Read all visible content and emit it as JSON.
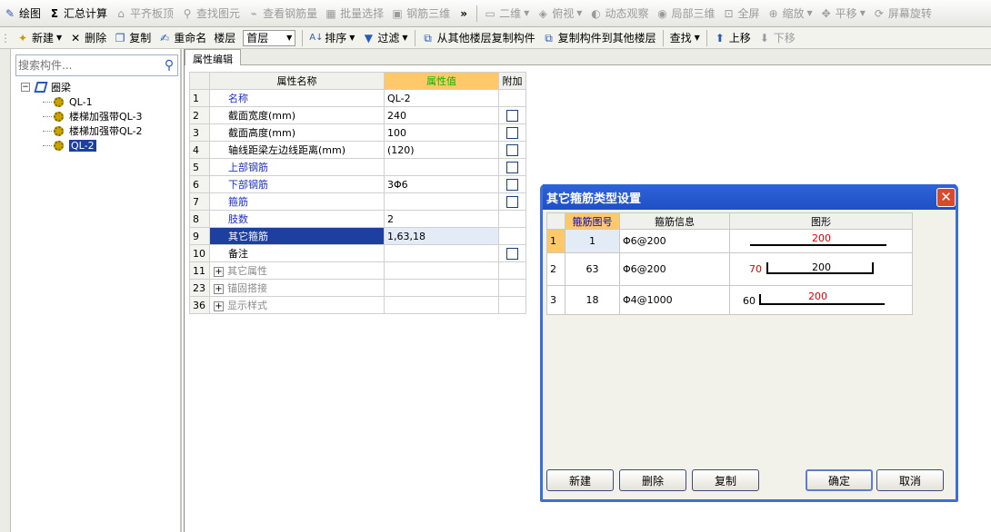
{
  "toolbar1": {
    "items": [
      {
        "label": "绘图",
        "icon": "draw-icon",
        "enabled": true
      },
      {
        "label": "汇总计算",
        "icon": "sigma-icon",
        "enabled": true
      },
      {
        "label": "平齐板顶",
        "icon": "align-icon",
        "enabled": false
      },
      {
        "label": "查找图元",
        "icon": "binoculars-icon",
        "enabled": false
      },
      {
        "label": "查看钢筋量",
        "icon": "view-rebar-icon",
        "enabled": false
      },
      {
        "label": "批量选择",
        "icon": "batch-select-icon",
        "enabled": false
      },
      {
        "label": "钢筋三维",
        "icon": "rebar-3d-icon",
        "enabled": false
      }
    ],
    "overflow": "»",
    "items_right": [
      {
        "label": "二维",
        "icon": "2d-icon",
        "dropdown": true
      },
      {
        "label": "俯视",
        "icon": "topview-icon",
        "dropdown": true
      },
      {
        "label": "动态观察",
        "icon": "orbit-icon",
        "dropdown": false
      },
      {
        "label": "局部三维",
        "icon": "local-3d-icon",
        "dropdown": false
      },
      {
        "label": "全屏",
        "icon": "fullscreen-icon",
        "dropdown": false
      },
      {
        "label": "缩放",
        "icon": "zoom-icon",
        "dropdown": true
      },
      {
        "label": "平移",
        "icon": "pan-icon",
        "dropdown": true
      },
      {
        "label": "屏幕旋转",
        "icon": "rotate-icon",
        "dropdown": false
      }
    ]
  },
  "toolbar2": {
    "new_label": "新建",
    "delete_label": "删除",
    "copy_label": "复制",
    "rename_label": "重命名",
    "floor_label": "楼层",
    "floor_value": "首层",
    "sort_label": "排序",
    "filter_label": "过滤",
    "copy_from_floor_label": "从其他楼层复制构件",
    "copy_to_floor_label": "复制构件到其他楼层",
    "find_label": "查找",
    "move_up_label": "上移",
    "move_down_label": "下移"
  },
  "left_panel": {
    "search_placeholder": "搜索构件...",
    "tree": {
      "root_label": "圈梁",
      "items": [
        "QL-1",
        "楼梯加强带QL-3",
        "楼梯加强带QL-2",
        "QL-2"
      ],
      "selected": "QL-2"
    }
  },
  "property_panel": {
    "tab_label": "属性编辑",
    "columns": [
      "属性名称",
      "属性值",
      "附加"
    ],
    "rows": [
      {
        "num": "1",
        "name": "名称",
        "value": "QL-2",
        "style": "blue",
        "checkbox": false
      },
      {
        "num": "2",
        "name": "截面宽度(mm)",
        "value": "240",
        "style": "black",
        "checkbox": true
      },
      {
        "num": "3",
        "name": "截面高度(mm)",
        "value": "100",
        "style": "black",
        "checkbox": true
      },
      {
        "num": "4",
        "name": "轴线距梁左边线距离(mm)",
        "value": "(120)",
        "style": "black",
        "checkbox": true
      },
      {
        "num": "5",
        "name": "上部钢筋",
        "value": "",
        "style": "blue",
        "checkbox": true
      },
      {
        "num": "6",
        "name": "下部钢筋",
        "value": "3Φ6",
        "style": "blue",
        "checkbox": true
      },
      {
        "num": "7",
        "name": "箍筋",
        "value": "",
        "style": "blue",
        "checkbox": true
      },
      {
        "num": "8",
        "name": "肢数",
        "value": "2",
        "style": "blue",
        "checkbox": false
      },
      {
        "num": "9",
        "name": "其它箍筋",
        "value": "1,63,18",
        "style": "selected",
        "checkbox": false
      },
      {
        "num": "10",
        "name": "备注",
        "value": "",
        "style": "black",
        "checkbox": true
      },
      {
        "num": "11",
        "name": "其它属性",
        "value": "",
        "style": "grey",
        "checkbox": false,
        "expand": "+"
      },
      {
        "num": "23",
        "name": "锚固搭接",
        "value": "",
        "style": "grey",
        "checkbox": false,
        "expand": "+"
      },
      {
        "num": "36",
        "name": "显示样式",
        "value": "",
        "style": "grey",
        "checkbox": false,
        "expand": "+"
      }
    ]
  },
  "dialog": {
    "title": "其它箍筋类型设置",
    "close_symbol": "✕",
    "columns": [
      "箍筋图号",
      "箍筋信息",
      "图形"
    ],
    "rows": [
      {
        "num": "1",
        "shape_no": "1",
        "info": "Φ6@200",
        "dims": {
          "main": "200"
        }
      },
      {
        "num": "2",
        "shape_no": "63",
        "info": "Φ6@200",
        "dims": {
          "left": "70",
          "main": "200"
        }
      },
      {
        "num": "3",
        "shape_no": "18",
        "info": "Φ4@1000",
        "dims": {
          "left": "60",
          "main": "200"
        }
      }
    ],
    "buttons": {
      "new": "新建",
      "delete": "删除",
      "copy": "复制",
      "ok": "确定",
      "cancel": "取消"
    }
  }
}
